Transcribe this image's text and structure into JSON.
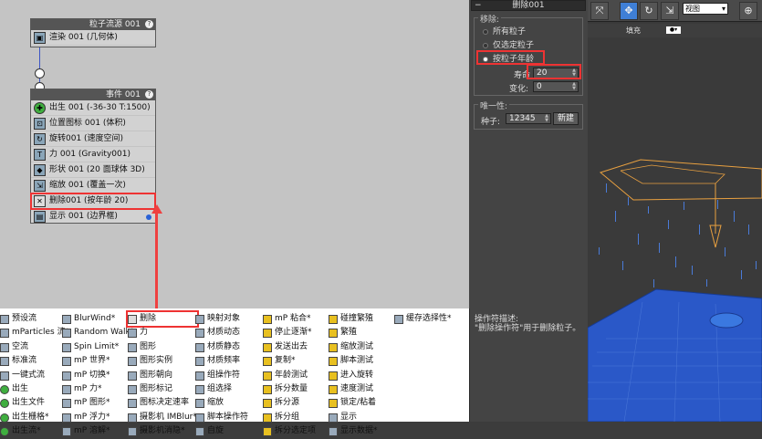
{
  "node_graph": {
    "source_node": {
      "title": "粒子流源 001",
      "render_op": "渲染 001 (几何体)"
    },
    "event_node": {
      "title": "事件 001",
      "ops": [
        "出生 001 (-36-30 T:1500)",
        "位置图标 001 (体积)",
        "旋转001 (速度空间)",
        "力 001 (Gravity001)",
        "形状 001 (20 面球体 3D)",
        "缩放 001 (覆盖一次)",
        "删除001 (按年龄 20)",
        "显示 001 (边界框)"
      ]
    }
  },
  "depot": {
    "col1": [
      "预设流",
      "mParticles 流*",
      "空流",
      "标准流",
      "一键式流",
      "出生",
      "出生文件",
      "出生栅格*",
      "出生流*"
    ],
    "col2": [
      "BlurWind*",
      "Random Walk*",
      "Spin Limit*",
      "mP 世界*",
      "mP 切换*",
      "mP 力*",
      "mP 图形*",
      "mP 浮力*",
      "mP 溶解*"
    ],
    "col3": [
      "删除",
      "力",
      "图形",
      "图形实例",
      "图形朝向",
      "图形标记",
      "图标决定速率",
      "摄影机 IMBlur*",
      "摄影机消隐*"
    ],
    "col4": [
      "映射对象",
      "材质动态",
      "材质静态",
      "材质频率",
      "组操作符",
      "组选择",
      "缩放",
      "脚本操作符",
      "自旋"
    ],
    "col5": [
      "mP 粘合*",
      "停止逐渐*",
      "发送出去",
      "复制*",
      "年龄测试",
      "拆分数量",
      "拆分源",
      "拆分组",
      "拆分选定项"
    ],
    "col6": [
      "碰撞繁殖",
      "繁殖",
      "缩放测试",
      "脚本测试",
      "进入旋转",
      "速度测试",
      "锁定/粘着",
      "显示",
      "显示数据*"
    ],
    "col7": [
      "缓存选择性*"
    ]
  },
  "rollout": {
    "title": "删除001",
    "remove_label": "移除:",
    "radio_all": "所有粒子",
    "radio_selected": "仅选定粒子",
    "radio_age": "按粒子年龄",
    "life_label": "寿命",
    "life_value": "20",
    "variation_label": "变化:",
    "variation_value": "0",
    "uniqueness_label": "唯一性:",
    "seed_label": "种子:",
    "seed_value": "12345",
    "new_button": "新建"
  },
  "description": {
    "header": "操作符描述:",
    "text": "\"删除操作符\"用于删除粒子。"
  },
  "viewport": {
    "view_dropdown": "视图",
    "tab_fill": "填充"
  },
  "colors": {
    "highlight": "#ee3333",
    "particle_blue": "#2a62d6",
    "helper_orange": "#e8a040"
  }
}
